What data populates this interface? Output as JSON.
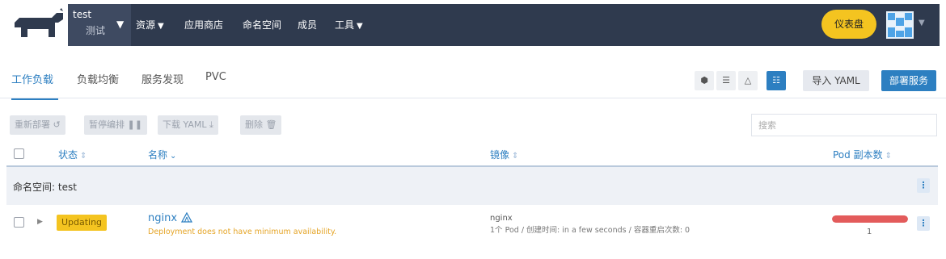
{
  "header": {
    "cluster_name": "test",
    "project_name": "测试",
    "menu": [
      {
        "label": "资源",
        "has_dropdown": true
      },
      {
        "label": "应用商店",
        "has_dropdown": false
      },
      {
        "label": "命名空间",
        "has_dropdown": false
      },
      {
        "label": "成员",
        "has_dropdown": false
      },
      {
        "label": "工具",
        "has_dropdown": true
      }
    ],
    "dashboard_label": "仪表盘",
    "colors": {
      "nav_bg": "#2f3a4e",
      "accent": "#f4c420",
      "primary": "#2d7fc1"
    }
  },
  "tabs": [
    {
      "label": "工作负载",
      "active": true
    },
    {
      "label": "负载均衡",
      "active": false
    },
    {
      "label": "服务发现",
      "active": false
    },
    {
      "label": "PVC",
      "active": false
    }
  ],
  "view_buttons": [
    "cube-icon",
    "list-icon",
    "tent-icon",
    "tree-list-icon"
  ],
  "import_label": "导入 YAML",
  "deploy_label": "部署服务",
  "actions": [
    {
      "label": "重新部署",
      "icon": "refresh-icon"
    },
    {
      "label": "暂停编排",
      "icon": "pause-icon"
    },
    {
      "label": "下载 YAML",
      "icon": "download-icon"
    },
    {
      "label": "删除",
      "icon": "trash-icon"
    }
  ],
  "search": {
    "placeholder": "搜索",
    "value": ""
  },
  "table": {
    "columns": [
      "状态",
      "名称",
      "镜像",
      "Pod 副本数"
    ],
    "group_label": "命名空间: test",
    "rows": [
      {
        "status": "Updating",
        "status_color": "#f4c420",
        "name": "nginx",
        "message": "Deployment does not have minimum availability.",
        "image": "nginx",
        "image_meta": "1个 Pod / 创建时间: in a few seconds / 容器重启次数: 0",
        "pod_count": "1",
        "pod_bar_fraction": 1.0,
        "pod_bar_color": "#e35b5b"
      }
    ]
  }
}
